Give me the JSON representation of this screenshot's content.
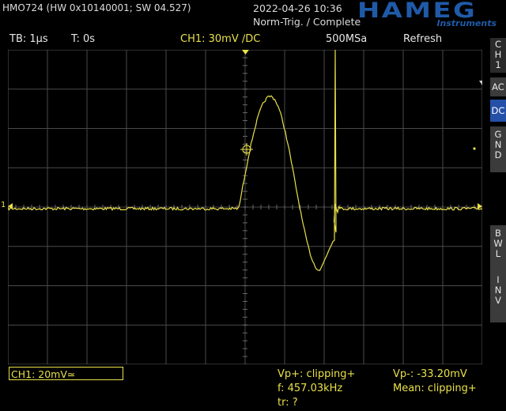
{
  "header": {
    "device": "HMO724 (HW 0x10140001; SW 04.527)",
    "datetime": "2022-04-26 10:36",
    "trigger_status": "Norm-Trig. / Complete",
    "brand": "HAMEG",
    "brand_sub": "Instruments"
  },
  "status_bar": {
    "timebase": "TB: 1µs",
    "trigger_time": "T: 0s",
    "channel": "CH1: 30mV ∕DC",
    "sample_rate": "500MSa",
    "acq_mode": "Refresh"
  },
  "side_menu": {
    "channel": [
      "C",
      "H",
      "1"
    ],
    "ac": "AC",
    "dc": "DC",
    "gnd": [
      "G",
      "N",
      "D"
    ],
    "bwl": [
      "B",
      "W",
      "L"
    ],
    "inv": [
      "I",
      "N",
      "V"
    ]
  },
  "bottom": {
    "probe": "CH1: 20mV≃",
    "vp_plus": "Vp+: clipping+",
    "vp_minus": "Vp-: -33.20mV",
    "frequency": "f: 457.03kHz",
    "mean": "Mean: clipping+",
    "rise": "tr: ?"
  },
  "colors": {
    "trace": "#e9e04a",
    "accent": "#2550a8",
    "grid": "#4a4a4a"
  },
  "markers": {
    "ground": "1"
  }
}
